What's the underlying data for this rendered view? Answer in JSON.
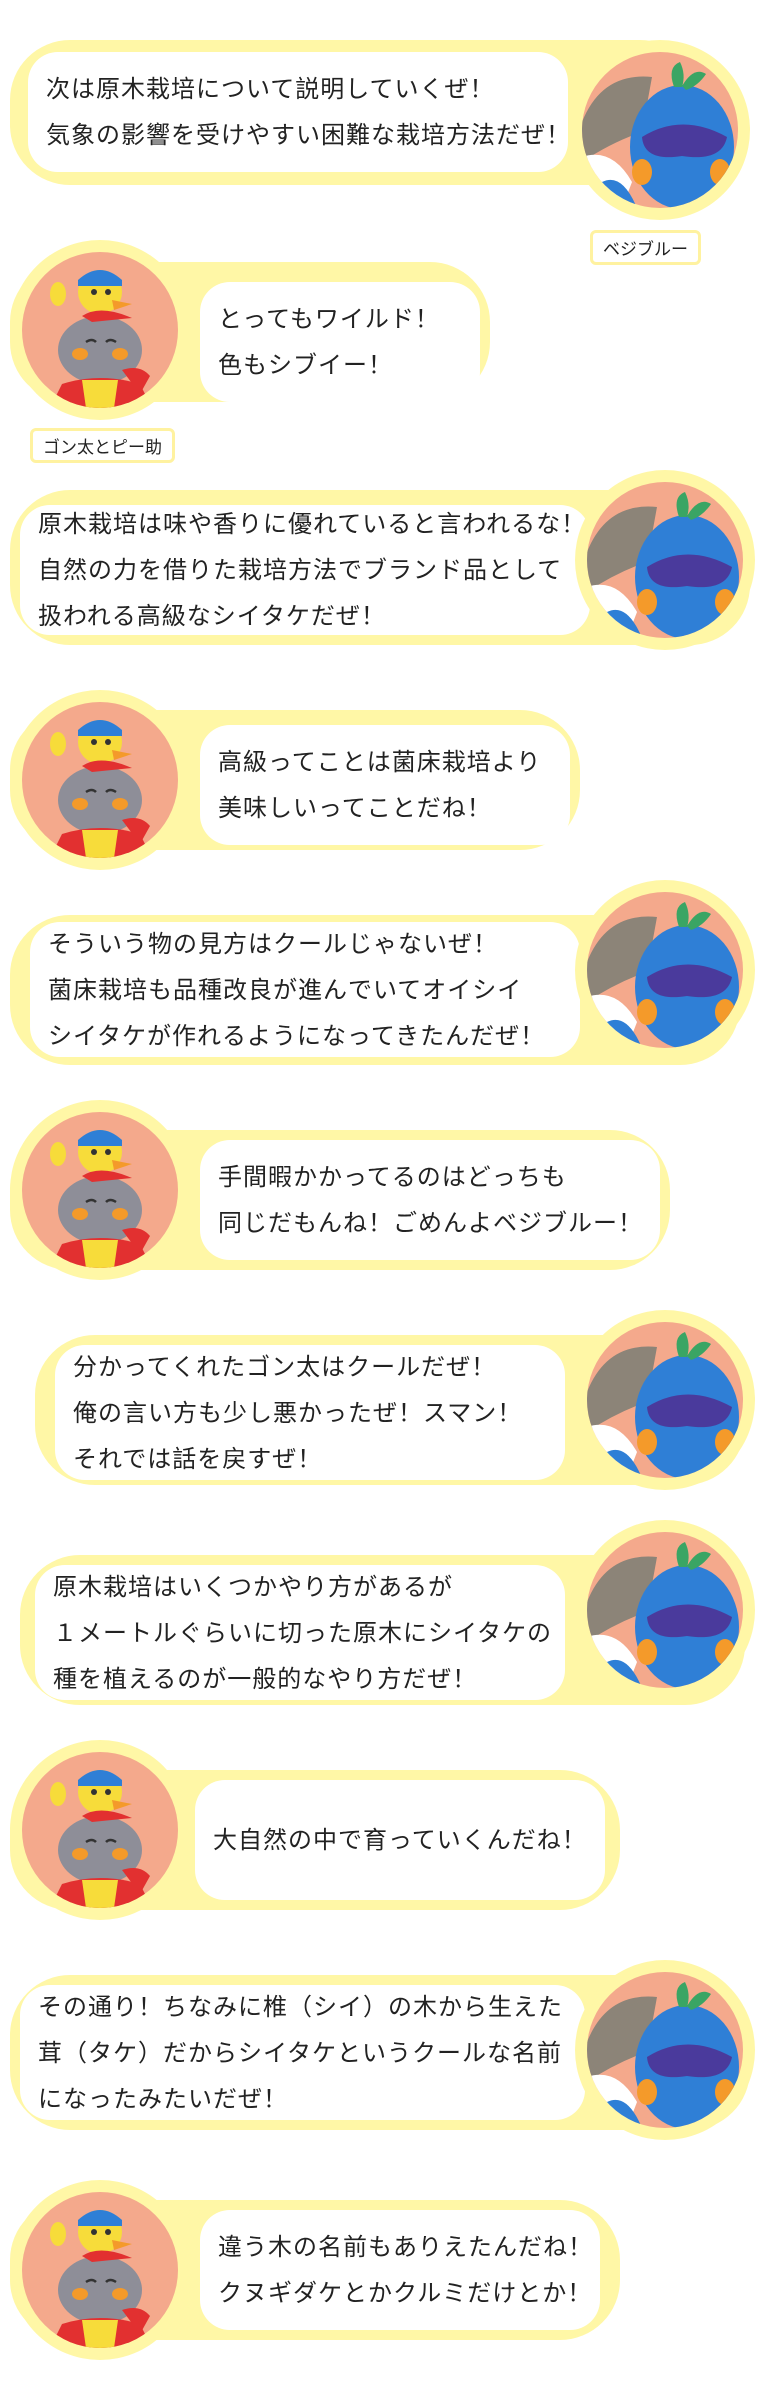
{
  "speakers": {
    "vege": "ベジブルー",
    "gon": "ゴン太とピー助"
  },
  "colors": {
    "halo": "#fff7a6",
    "avatar_bg": "#f4a98c",
    "vege_body": "#2f7fd6",
    "vege_mask": "#4a3a9c",
    "vege_leaf": "#3aa564"
  },
  "dialogue": [
    {
      "speaker": "vege",
      "lines": [
        "次は原木栽培について説明していくぜ！",
        "気象の影響を受けやすい困難な栽培方法だぜ！"
      ]
    },
    {
      "speaker": "gon",
      "lines": [
        "とってもワイルド！",
        "色もシブイー！"
      ]
    },
    {
      "speaker": "vege",
      "lines": [
        "原木栽培は味や香りに優れていると言われるな！",
        "自然の力を借りた栽培方法でブランド品として",
        "扱われる高級なシイタケだぜ！"
      ]
    },
    {
      "speaker": "gon",
      "lines": [
        "高級ってことは菌床栽培より",
        "美味しいってことだね！"
      ]
    },
    {
      "speaker": "vege",
      "lines": [
        "そういう物の見方はクールじゃないぜ！",
        "菌床栽培も品種改良が進んでいてオイシイ",
        "シイタケが作れるようになってきたんだぜ！"
      ]
    },
    {
      "speaker": "gon",
      "lines": [
        "手間暇かかってるのはどっちも",
        "同じだもんね！ごめんよベジブルー！"
      ]
    },
    {
      "speaker": "vege",
      "lines": [
        "分かってくれたゴン太はクールだぜ！",
        "俺の言い方も少し悪かったぜ！スマン！",
        "それでは話を戻すぜ！"
      ]
    },
    {
      "speaker": "vege",
      "lines": [
        "原木栽培はいくつかやり方があるが",
        "１メートルぐらいに切った原木にシイタケの",
        "種を植えるのが一般的なやり方だぜ！"
      ]
    },
    {
      "speaker": "gon",
      "lines": [
        "大自然の中で育っていくんだね！"
      ]
    },
    {
      "speaker": "vege",
      "lines": [
        "その通り！ちなみに椎（シイ）の木から生えた",
        "茸（タケ）だからシイタケというクールな名前",
        "になったみたいだぜ！"
      ]
    },
    {
      "speaker": "gon",
      "lines": [
        "違う木の名前もありえたんだね！",
        "クヌギダケとかクルミだけとか！"
      ]
    }
  ]
}
